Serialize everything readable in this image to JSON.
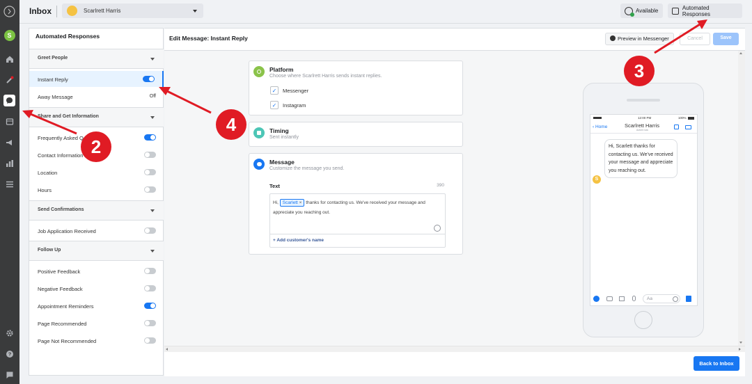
{
  "topbar": {
    "title": "Inbox",
    "page_name": "Scarlrett Harris",
    "available_label": "Available",
    "automated_label": "Automated Responses"
  },
  "left": {
    "title": "Automated Responses",
    "sections": [
      {
        "label": "Greet People",
        "items": [
          {
            "label": "Instant Reply",
            "state": "on"
          },
          {
            "label": "Away Message",
            "state": "Off"
          }
        ]
      },
      {
        "label": "Share and Get Information",
        "items": [
          {
            "label": "Frequently Asked Q",
            "state": "on"
          },
          {
            "label": "Contact Information",
            "state": "off"
          },
          {
            "label": "Location",
            "state": "off"
          },
          {
            "label": "Hours",
            "state": "off"
          }
        ]
      },
      {
        "label": "Send Confirmations",
        "items": [
          {
            "label": "Job Application Received",
            "state": "off"
          }
        ]
      },
      {
        "label": "Follow Up",
        "items": [
          {
            "label": "Positive Feedback",
            "state": "off"
          },
          {
            "label": "Negative Feedback",
            "state": "off"
          },
          {
            "label": "Appointment Reminders",
            "state": "on"
          },
          {
            "label": "Page Recommended",
            "state": "off"
          },
          {
            "label": "Page Not Recommended",
            "state": "off"
          }
        ]
      }
    ]
  },
  "edit": {
    "title": "Edit Message: Instant Reply",
    "preview_label": "Preview in Messenger",
    "cancel_label": "Cancel",
    "save_label": "Save",
    "back_label": "Back to Inbox"
  },
  "platform": {
    "title": "Platform",
    "subtitle": "Choose where Scarlrett Harris sends instant replies.",
    "options": [
      "Messenger",
      "Instagram"
    ]
  },
  "timing": {
    "title": "Timing",
    "subtitle": "Sent instantly"
  },
  "message": {
    "title": "Message",
    "subtitle": "Customize the message you send.",
    "text_label": "Text",
    "char_count": "390",
    "prefix": "Hi,",
    "name_token": "Scarlett",
    "body": "thanks for contacting us. We've received your message and appreciate you reaching out.",
    "add_name": "+ Add customer's name"
  },
  "phone": {
    "time": "12:00 PM",
    "battery": "100%",
    "home_label": "Home",
    "contact_name": "Scarlrett Harris",
    "contact_sub": "Active now",
    "bubble": "Hi, Scarlett thanks for contacting us. We've received your message and appreciate you reaching out.",
    "avatar_letter": "S",
    "input_placeholder": "Aa"
  },
  "annotations": [
    "2",
    "3",
    "4"
  ],
  "rail": {
    "avatar_letter": "S"
  },
  "colors": {
    "accent": "#1877f2",
    "annotation": "#e01b24",
    "rail": "#3a3b3c"
  }
}
